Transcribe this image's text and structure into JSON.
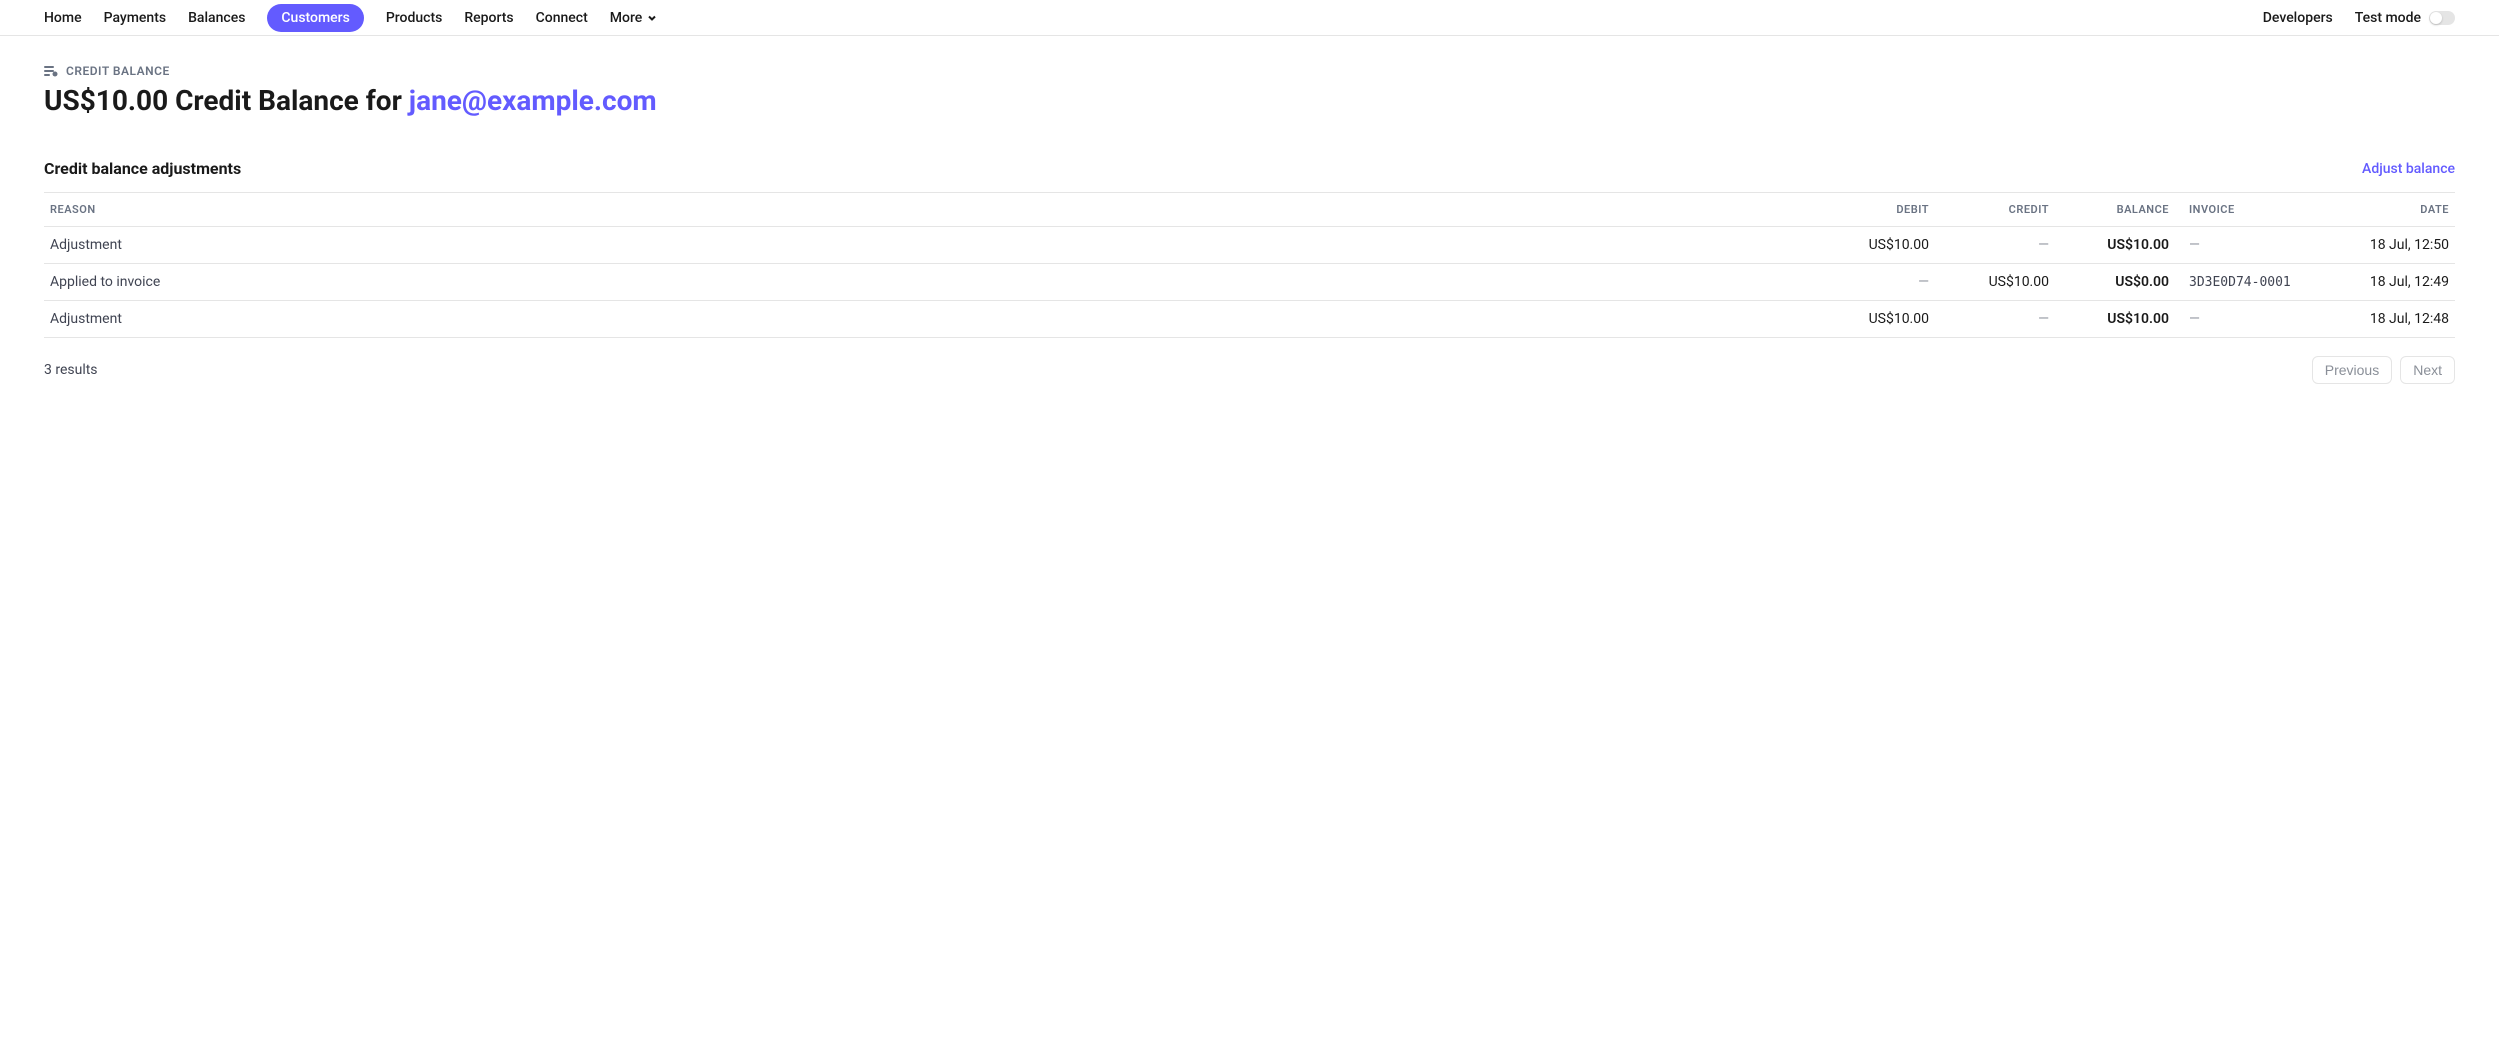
{
  "nav": {
    "left": [
      {
        "label": "Home",
        "active": false
      },
      {
        "label": "Payments",
        "active": false
      },
      {
        "label": "Balances",
        "active": false
      },
      {
        "label": "Customers",
        "active": true
      },
      {
        "label": "Products",
        "active": false
      },
      {
        "label": "Reports",
        "active": false
      },
      {
        "label": "Connect",
        "active": false
      }
    ],
    "more_label": "More",
    "developers_label": "Developers",
    "test_mode_label": "Test mode"
  },
  "page": {
    "eyebrow": "CREDIT BALANCE",
    "title_prefix": "US$10.00 Credit Balance for ",
    "title_email": "jane@example.com"
  },
  "section": {
    "title": "Credit balance adjustments",
    "action": "Adjust balance"
  },
  "table": {
    "headers": {
      "reason": "REASON",
      "debit": "DEBIT",
      "credit": "CREDIT",
      "balance": "BALANCE",
      "invoice": "INVOICE",
      "date": "DATE"
    },
    "rows": [
      {
        "reason": "Adjustment",
        "debit": "US$10.00",
        "credit": "—",
        "balance": "US$10.00",
        "invoice": "—",
        "date": "18 Jul, 12:50"
      },
      {
        "reason": "Applied to invoice",
        "debit": "—",
        "credit": "US$10.00",
        "balance": "US$0.00",
        "invoice": "3D3E0D74-0001",
        "date": "18 Jul, 12:49"
      },
      {
        "reason": "Adjustment",
        "debit": "US$10.00",
        "credit": "—",
        "balance": "US$10.00",
        "invoice": "—",
        "date": "18 Jul, 12:48"
      }
    ],
    "results_label": "3 results",
    "prev_label": "Previous",
    "next_label": "Next"
  }
}
